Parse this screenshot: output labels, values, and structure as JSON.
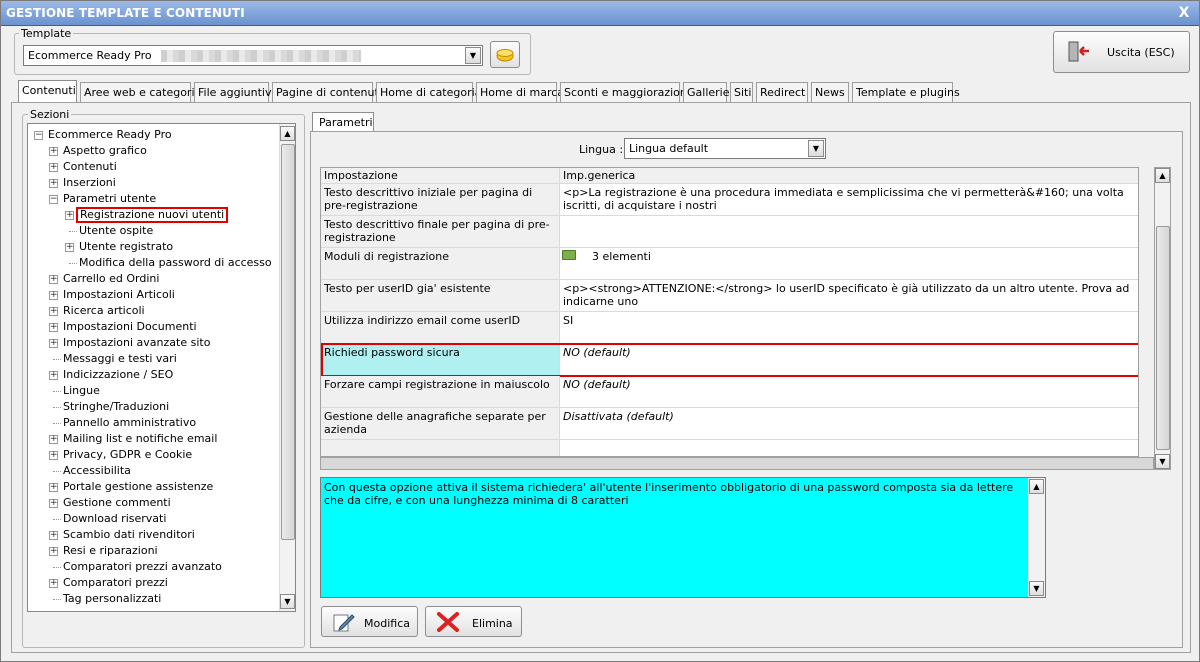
{
  "window": {
    "title": "GESTIONE TEMPLATE E CONTENUTI",
    "close_glyph": "X"
  },
  "template": {
    "legend": "Template",
    "selected": "Ecommerce Ready Pro",
    "icon": "folder-open-icon"
  },
  "exit_button": {
    "label": "Uscita (ESC)",
    "icon": "exit-door-icon"
  },
  "tabs": [
    "Contenuti",
    "Aree web e categorie",
    "File aggiuntivi",
    "Pagine di contenuti",
    "Home di categoria",
    "Home di marca",
    "Sconti e maggiorazioni",
    "Gallerie",
    "Siti",
    "Redirect",
    "News",
    "Template e plugins"
  ],
  "sections": {
    "legend": "Sezioni",
    "tree": [
      {
        "label": "Ecommerce Ready Pro",
        "level": 0,
        "exp": "-"
      },
      {
        "label": "Aspetto grafico",
        "level": 1,
        "exp": "+"
      },
      {
        "label": "Contenuti",
        "level": 1,
        "exp": "+"
      },
      {
        "label": "Inserzioni",
        "level": 1,
        "exp": "+"
      },
      {
        "label": "Parametri utente",
        "level": 1,
        "exp": "-"
      },
      {
        "label": "Registrazione nuovi utenti",
        "level": 2,
        "exp": "+",
        "selected": true
      },
      {
        "label": "Utente ospite",
        "level": 2,
        "exp": ""
      },
      {
        "label": "Utente registrato",
        "level": 2,
        "exp": "+"
      },
      {
        "label": "Modifica della password di accesso",
        "level": 2,
        "exp": ""
      },
      {
        "label": "Carrello ed Ordini",
        "level": 1,
        "exp": "+"
      },
      {
        "label": "Impostazioni Articoli",
        "level": 1,
        "exp": "+"
      },
      {
        "label": "Ricerca articoli",
        "level": 1,
        "exp": "+"
      },
      {
        "label": "Impostazioni Documenti",
        "level": 1,
        "exp": "+"
      },
      {
        "label": "Impostazioni avanzate sito",
        "level": 1,
        "exp": "+"
      },
      {
        "label": "Messaggi e testi vari",
        "level": 1,
        "exp": ""
      },
      {
        "label": "Indicizzazione / SEO",
        "level": 1,
        "exp": "+"
      },
      {
        "label": "Lingue",
        "level": 1,
        "exp": ""
      },
      {
        "label": "Stringhe/Traduzioni",
        "level": 1,
        "exp": ""
      },
      {
        "label": "Pannello amministrativo",
        "level": 1,
        "exp": ""
      },
      {
        "label": "Mailing list e notifiche email",
        "level": 1,
        "exp": "+"
      },
      {
        "label": "Privacy, GDPR e Cookie",
        "level": 1,
        "exp": "+"
      },
      {
        "label": "Accessibilita",
        "level": 1,
        "exp": ""
      },
      {
        "label": "Portale gestione assistenze",
        "level": 1,
        "exp": "+"
      },
      {
        "label": "Gestione commenti",
        "level": 1,
        "exp": "+"
      },
      {
        "label": "Download riservati",
        "level": 1,
        "exp": ""
      },
      {
        "label": "Scambio dati rivenditori",
        "level": 1,
        "exp": "+"
      },
      {
        "label": "Resi e riparazioni",
        "level": 1,
        "exp": "+"
      },
      {
        "label": "Comparatori prezzi avanzato",
        "level": 1,
        "exp": ""
      },
      {
        "label": "Comparatori prezzi",
        "level": 1,
        "exp": "+"
      },
      {
        "label": "Tag personalizzati",
        "level": 1,
        "exp": ""
      }
    ]
  },
  "params": {
    "tab": "Parametri",
    "lingua_label": "Lingua :",
    "lingua_value": "Lingua default",
    "headers": [
      "Impostazione",
      "Imp.generica"
    ],
    "rows": [
      {
        "name": "Testo descrittivo iniziale per pagina di pre-registrazione",
        "value": "<p>La registrazione è una procedura immediata e semplicissima che vi permetterà&#160; una volta iscritti, di acquistare i nostri",
        "italic": false
      },
      {
        "name": "Testo descrittivo finale per pagina di pre-registrazione",
        "value": "",
        "italic": false
      },
      {
        "name": "Moduli di registrazione",
        "value": "3 elementi",
        "italic": false,
        "icon": "folder-icon"
      },
      {
        "name": "Testo per userID gia' esistente",
        "value": "<p><strong>ATTENZIONE:</strong> lo userID specificato è già utilizzato da un altro utente. Prova ad indicarne uno",
        "italic": false
      },
      {
        "name": "Utilizza indirizzo email come userID",
        "value": "SI",
        "italic": false
      },
      {
        "name": "Richiedi password sicura",
        "value": "NO (default)",
        "italic": true,
        "selected": true
      },
      {
        "name": "Forzare campi registrazione in maiuscolo",
        "value": "NO (default)",
        "italic": true
      },
      {
        "name": "Gestione delle anagrafiche separate per azienda",
        "value": "Disattivata (default)",
        "italic": true
      },
      {
        "name": "",
        "value": "",
        "italic": false
      }
    ],
    "description": "Con questa opzione attiva il sistema richiedera' all'utente l'inserimento obbligatorio di una password composta sia da lettere che da cifre, e con una lunghezza minima di 8 caratteri"
  },
  "actions": {
    "edit": "Modifica",
    "delete": "Elimina"
  },
  "colors": {
    "selected_row": "#b0f0f0",
    "description_bg": "#00ffff",
    "highlight": "#e00000"
  }
}
